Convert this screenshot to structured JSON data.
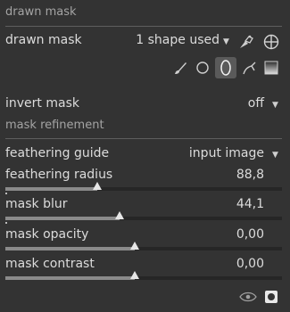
{
  "drawn_mask_section": {
    "title": "drawn mask"
  },
  "drawn_mask": {
    "label": "drawn mask",
    "value": "1 shape used",
    "icons": [
      "show-and-edit-icon",
      "add-existing-shape-icon"
    ],
    "shape_tools": [
      "brush-icon",
      "circle-icon",
      "ellipse-icon",
      "path-icon",
      "gradient-icon"
    ],
    "active_tool": "ellipse-icon"
  },
  "invert_mask": {
    "label": "invert mask",
    "value": "off"
  },
  "refinement_section": {
    "title": "mask refinement"
  },
  "feathering_guide": {
    "label": "feathering guide",
    "value": "input image"
  },
  "sliders": [
    {
      "label": "feathering radius",
      "value": "88,8",
      "fraction": 0.333
    },
    {
      "label": "mask blur",
      "value": "44,1",
      "fraction": 0.413
    },
    {
      "label": "mask opacity",
      "value": "0,00",
      "fraction": 0.467
    },
    {
      "label": "mask contrast",
      "value": "0,00",
      "fraction": 0.467
    }
  ],
  "footer": {
    "icons": [
      "eye-icon",
      "display-mask-icon"
    ]
  }
}
